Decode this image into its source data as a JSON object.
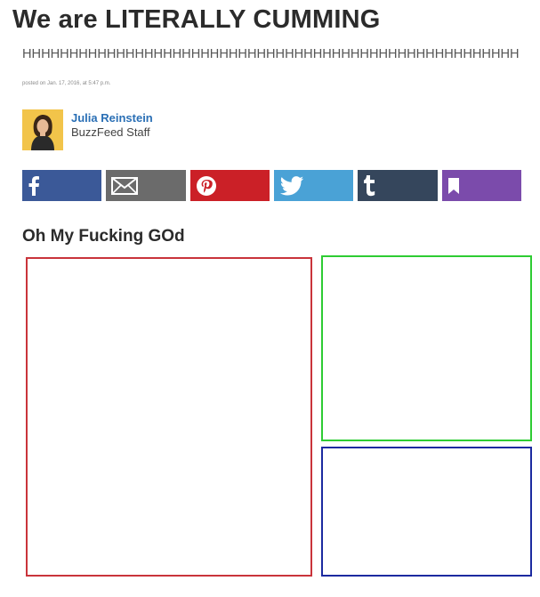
{
  "article": {
    "title": "We are LITERALLY CUMMING",
    "dek": "HHHHHHHHHHHHHHHHHHHHHHHHHHHHHHHHHHHHHHHHHHHHHHHHHHHHH",
    "posted": "posted on Jan. 17, 2016, at 5:47 p.m.",
    "subheading": "Oh My Fucking GOd"
  },
  "author": {
    "name": "Julia Reinstein",
    "role": "BuzzFeed Staff",
    "avatar_icon": "author-avatar"
  },
  "share": {
    "buttons": [
      {
        "icon": "facebook-icon",
        "color": "#3b5998"
      },
      {
        "icon": "email-icon",
        "color": "#6b6b6b"
      },
      {
        "icon": "pinterest-icon",
        "color": "#cb2027"
      },
      {
        "icon": "twitter-icon",
        "color": "#4aa2d6"
      },
      {
        "icon": "tumblr-icon",
        "color": "#35465c"
      },
      {
        "icon": "bookmark-icon",
        "color": "#7b4bab"
      }
    ]
  },
  "boxes": {
    "red": "#c9343b",
    "green": "#2ecc33",
    "blue": "#1c2aa0"
  }
}
